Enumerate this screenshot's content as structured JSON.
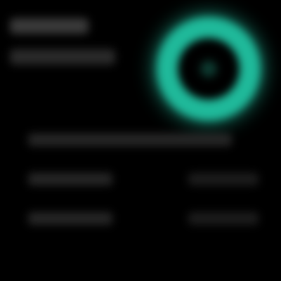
{
  "colors": {
    "background": "#000000",
    "accent": "#1fb99a",
    "text_placeholder": "#2a2a2a"
  },
  "header": {
    "title_icon": "blurred-title",
    "subtitle_icon": "blurred-subtitle"
  },
  "progress_ring": {
    "icon": "ring-progress-icon",
    "value_fraction": 1.0
  },
  "list": {
    "items": [
      {
        "icon": "blurred-row"
      },
      {
        "icon": "blurred-row"
      },
      {
        "icon": "blurred-row"
      }
    ]
  }
}
